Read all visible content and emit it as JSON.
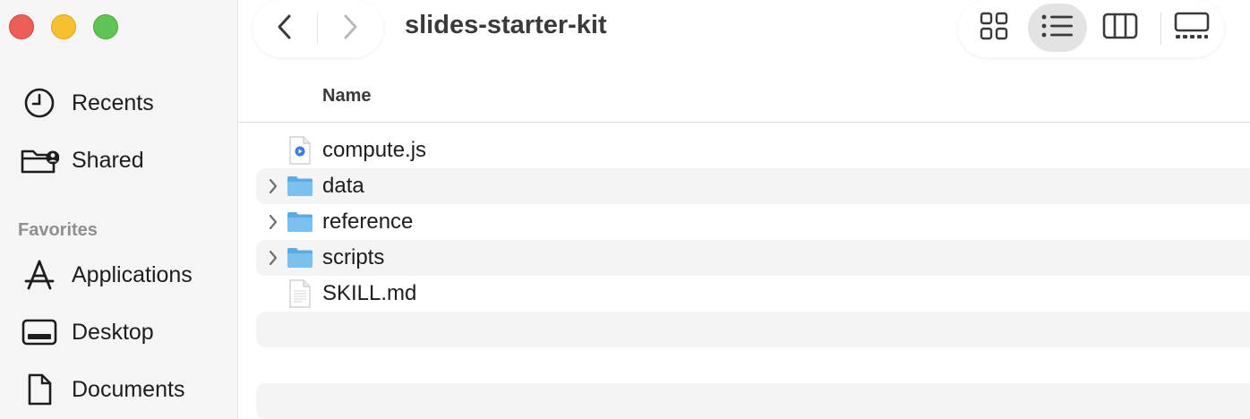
{
  "window": {
    "title": "slides-starter-kit"
  },
  "sidebar": {
    "items_top": [
      {
        "label": "Recents",
        "icon": "clock-icon"
      },
      {
        "label": "Shared",
        "icon": "shared-folder-icon"
      }
    ],
    "section_title": "Favorites",
    "favorites": [
      {
        "label": "Applications",
        "icon": "applications-icon"
      },
      {
        "label": "Desktop",
        "icon": "desktop-icon"
      },
      {
        "label": "Documents",
        "icon": "document-icon"
      }
    ]
  },
  "toolbar": {
    "back_icon": "chevron-left-icon",
    "forward_icon": "chevron-right-icon",
    "views": [
      "icon-view",
      "list-view",
      "column-view",
      "gallery-view"
    ],
    "active_view": "list-view"
  },
  "list": {
    "header": "Name",
    "rows": [
      {
        "name": "compute.js",
        "type": "js-file"
      },
      {
        "name": "data",
        "type": "folder"
      },
      {
        "name": "reference",
        "type": "folder"
      },
      {
        "name": "scripts",
        "type": "folder"
      },
      {
        "name": "SKILL.md",
        "type": "text-file"
      }
    ]
  },
  "colors": {
    "folder": "#6cb6ec",
    "sidebar_bg": "#f5f5f5",
    "row_alt": "#f4f4f4"
  }
}
